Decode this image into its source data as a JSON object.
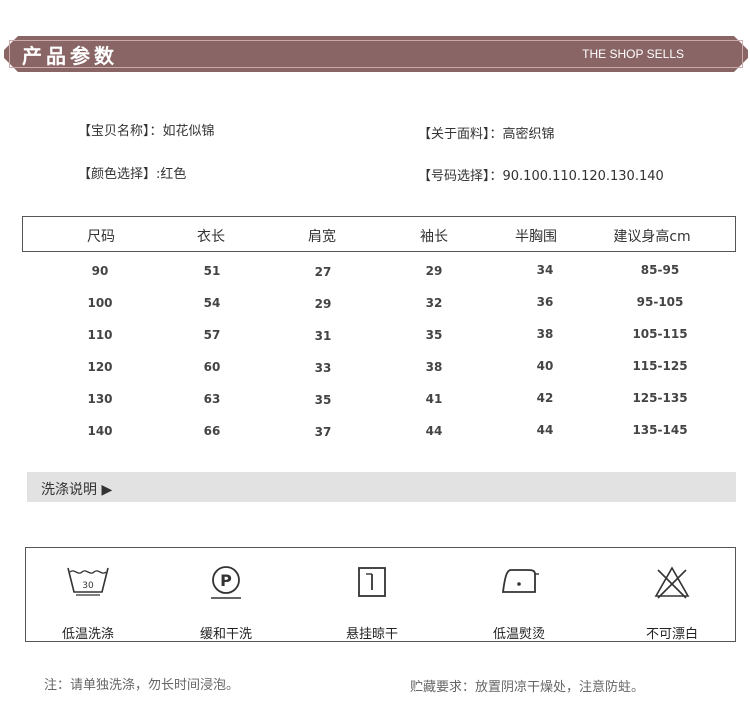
{
  "banner": {
    "title": "产品参数",
    "subtitle": "THE SHOP SELLS"
  },
  "info": {
    "name_label": "【宝贝名称】：如花似锦",
    "fabric_label": "【关于面料】：高密织锦",
    "color_label": "【颜色选择】:红色",
    "size_label": "【号码选择】：90.100.110.120.130.140"
  },
  "size_table": {
    "headers": [
      "尺码",
      "衣长",
      "肩宽",
      "袖长",
      "半胸围",
      "建议身高cm"
    ],
    "rows": [
      [
        "90",
        "51",
        "27",
        "29",
        "34",
        "85-95"
      ],
      [
        "100",
        "54",
        "29",
        "32",
        "36",
        "95-105"
      ],
      [
        "110",
        "57",
        "31",
        "35",
        "38",
        "105-115"
      ],
      [
        "120",
        "60",
        "33",
        "38",
        "40",
        "115-125"
      ],
      [
        "130",
        "63",
        "35",
        "41",
        "42",
        "125-135"
      ],
      [
        "140",
        "66",
        "37",
        "44",
        "44",
        "135-145"
      ]
    ]
  },
  "wash": {
    "title": "洗涤说明 ▶"
  },
  "care": [
    {
      "icon": "wash-30-icon",
      "label": "低温洗涤",
      "temp": "30"
    },
    {
      "icon": "dry-clean-p-icon",
      "label": "缓和干洗",
      "letter": "P"
    },
    {
      "icon": "hang-dry-icon",
      "label": "悬挂晾干"
    },
    {
      "icon": "low-iron-icon",
      "label": "低温熨烫"
    },
    {
      "icon": "no-bleach-icon",
      "label": "不可漂白"
    }
  ],
  "notes": {
    "left": "注：请单独洗涤，勿长时间浸泡。",
    "right": "贮藏要求：放置阴凉干燥处，注意防蛀。"
  }
}
